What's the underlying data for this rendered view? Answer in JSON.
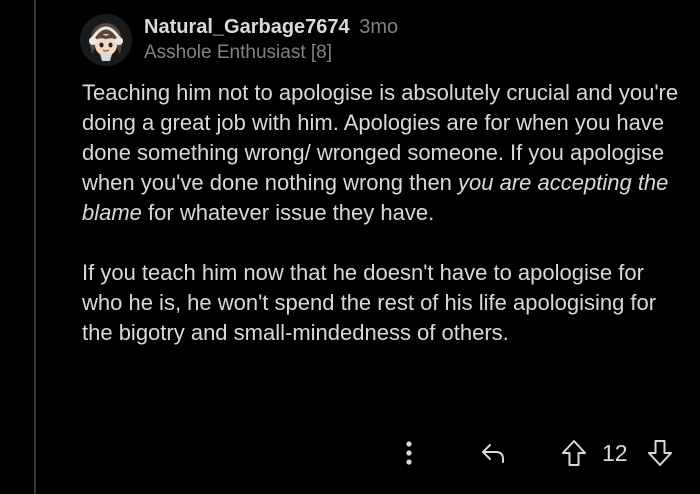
{
  "comment": {
    "username": "Natural_Garbage7674",
    "time": "3mo",
    "flair": "Asshole Enthusiast [8]",
    "paragraph1": {
      "part1": "Teaching him not to apologise is absolutely crucial and you're doing a great job with him. Apologies are for when you have done something wrong/ wronged someone. If you apologise when you've done nothing wrong then ",
      "emphasis": "you are accepting the blame",
      "part2": " for whatever issue they have."
    },
    "paragraph2": "If you teach him now that he doesn't have to apologise for who he is, he won't spend the rest of his life apologising for the bigotry and small-mindedness of others.",
    "score": "12"
  },
  "icons": {
    "more": "more-vertical-icon",
    "reply": "reply-arrow-icon",
    "upvote": "upvote-arrow-icon",
    "downvote": "downvote-arrow-icon"
  },
  "colors": {
    "background": "#000000",
    "text": "#d7dadc",
    "muted": "#818384",
    "thread_line": "#343536"
  }
}
